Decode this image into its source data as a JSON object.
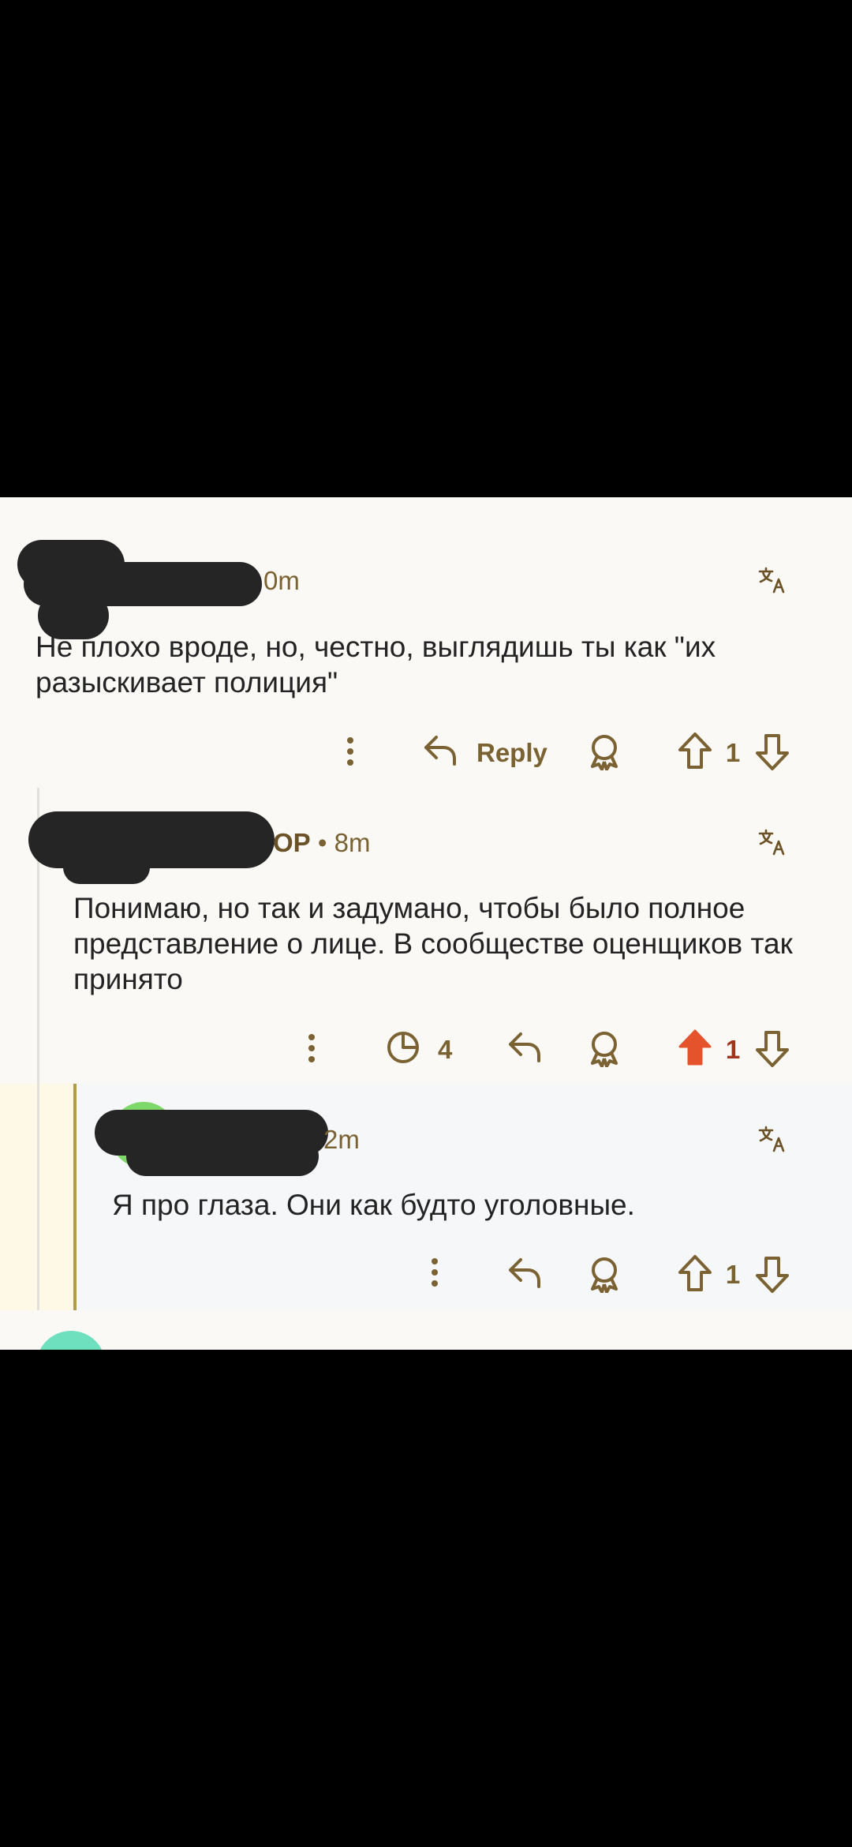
{
  "comments": [
    {
      "id": "c1",
      "time": "0m",
      "text": "Не плохо вроде, но, честно, выглядишь ты как \"их разыскивает полиция\"",
      "reply_label": "Reply",
      "score": "1",
      "upvoted": false
    },
    {
      "id": "c2",
      "op_label": "OP",
      "separator": "•",
      "time": "8m",
      "text": "Понимаю, но так и задумано, чтобы было полное представление о лице. В сообществе оценщиков так принято",
      "views": "4",
      "score": "1",
      "upvoted": true
    },
    {
      "id": "c3",
      "time": "2m",
      "text": "Я про глаза. Они как будто уголовные.",
      "score": "1",
      "upvoted": false
    }
  ],
  "colors": {
    "accent": "#7a6232",
    "upvote_active": "#e5532c",
    "score_active": "#a0341d",
    "panel_bg": "#fbf9f5",
    "highlight_bg": "#fef9e6"
  }
}
